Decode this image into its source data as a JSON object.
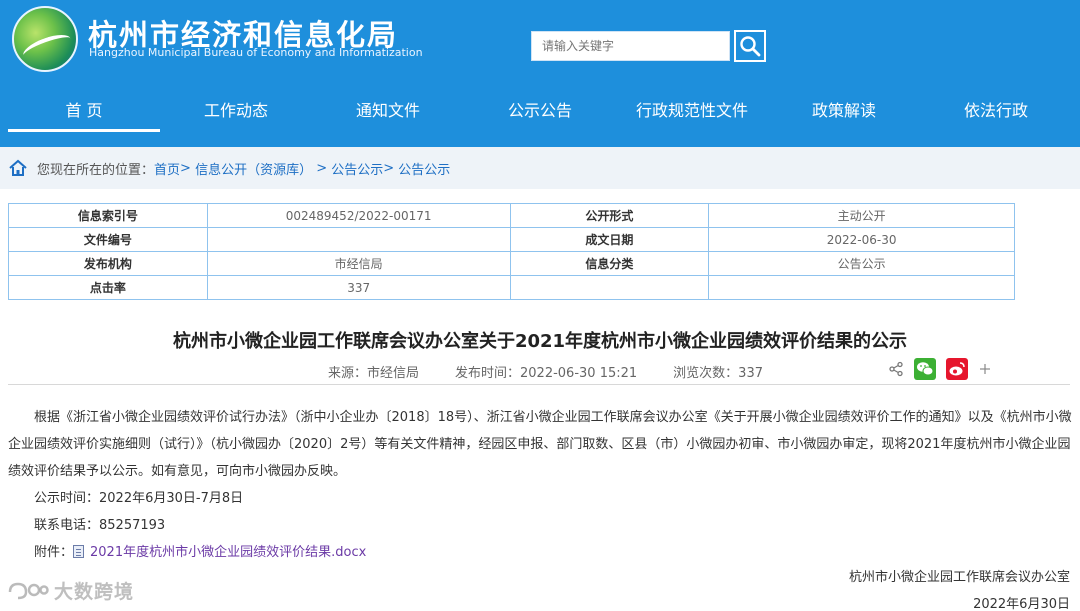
{
  "header": {
    "title_cn": "杭州市经济和信息化局",
    "title_en": "Hangzhou Municipal Bureau of Economy and Informatization"
  },
  "search": {
    "placeholder": "请输入关键字"
  },
  "nav": [
    {
      "label": "首 页",
      "active": true
    },
    {
      "label": "工作动态"
    },
    {
      "label": "通知文件"
    },
    {
      "label": "公示公告"
    },
    {
      "label": "行政规范性文件"
    },
    {
      "label": "政策解读"
    },
    {
      "label": "依法行政"
    }
  ],
  "breadcrumb": {
    "label": "您现在所在的位置：",
    "items": [
      "首页",
      "信息公开（资源库）",
      "公告公示",
      "公告公示"
    ]
  },
  "info": {
    "index_label": "信息索引号",
    "index_value": "002489452/2022-00171",
    "public_form_label": "公开形式",
    "public_form_value": "主动公开",
    "file_no_label": "文件编号",
    "file_no_value": "",
    "date_label": "成文日期",
    "date_value": "2022-06-30",
    "publisher_label": "发布机构",
    "publisher_value": "市经信局",
    "category_label": "信息分类",
    "category_value": "公告公示",
    "clicks_label": "点击率",
    "clicks_value": "337"
  },
  "article": {
    "title": "杭州市小微企业园工作联席会议办公室关于2021年度杭州市小微企业园绩效评价结果的公示",
    "source": "来源：市经信局",
    "published": "发布时间：2022-06-30 15:21",
    "views": "浏览次数：337",
    "paragraph": "根据《浙江省小微企业园绩效评价试行办法》（浙中小企业办〔2018〕18号）、浙江省小微企业园工作联席会议办公室《关于开展小微企业园绩效评价工作的通知》以及《杭州市小微企业园绩效评价实施细则（试行）》（杭小微园办〔2020〕2号）等有关文件精神，经园区申报、部门取数、区县（市）小微园办初审、市小微园办审定，现将2021年度杭州市小微企业园绩效评价结果予以公示。如有意见，可向市小微园办反映。",
    "period": "公示时间：2022年6月30日-7月8日",
    "phone": "联系电话：85257193",
    "attach_label": "附件：",
    "attach_name": "2021年度杭州市小微企业园绩效评价结果.docx",
    "sign_org": "杭州市小微企业园工作联席会议办公室",
    "sign_date": "2022年6月30日"
  },
  "share_icons": [
    "share-icon",
    "wechat-icon",
    "weibo-icon",
    "plus-icon"
  ],
  "watermark": {
    "text": "大数跨境"
  },
  "colors": {
    "brand": "#1e8fdc",
    "link": "#1e6fc4",
    "attachment": "#6b3aa6",
    "table_border": "#8fc3ee"
  }
}
